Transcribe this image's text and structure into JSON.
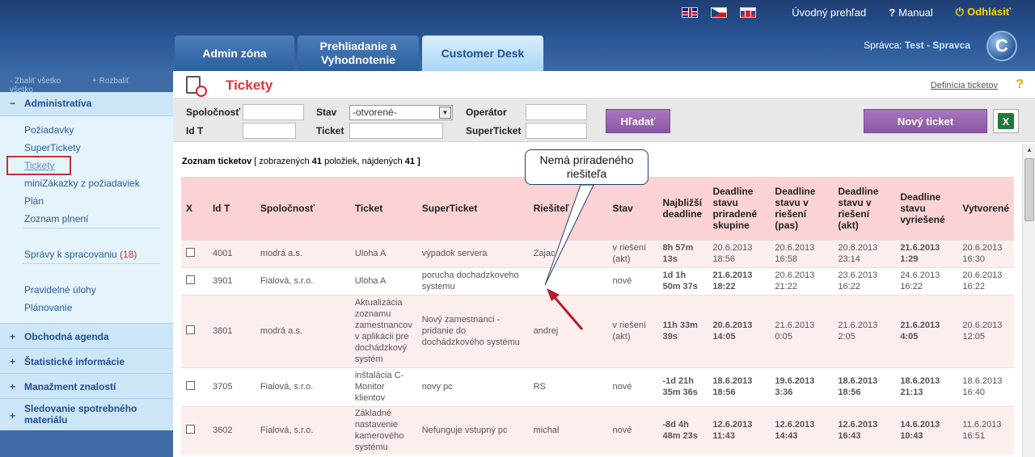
{
  "header": {
    "nav": {
      "overview": "Úvodný prehľad",
      "manual": "Manual",
      "logout": "Odhlásiť"
    },
    "tabs": [
      {
        "label": "Admin zóna"
      },
      {
        "label": "Prehliadanie a Vyhodnotenie"
      },
      {
        "label": "Customer Desk"
      }
    ],
    "admin_prefix": "Správca:",
    "admin_name": "Test - Spravca",
    "logo_letter": "C"
  },
  "sidebar": {
    "collapse_all": "Zbaliť všetko",
    "expand_all": "Rozbaliť všetko",
    "section_admin": "Administratíva",
    "items": [
      {
        "label": "Požiadavky"
      },
      {
        "label": "SuperTickety"
      },
      {
        "label": "Tickety"
      },
      {
        "label": "miniZákazky z požiadaviek"
      },
      {
        "label": "Plán"
      },
      {
        "label": "Zoznam plnení"
      },
      {
        "label": "Správy k spracovaniu"
      },
      {
        "label": "Pravidelné úlohy"
      },
      {
        "label": "Plánovanie"
      }
    ],
    "reports_count": "(18)",
    "sections": [
      {
        "label": "Obchodná agenda"
      },
      {
        "label": "Štatistické informácie"
      },
      {
        "label": "Manažment znalostí"
      },
      {
        "label": "Sledovanie spotrebného materiálu"
      }
    ]
  },
  "page": {
    "title": "Tickety",
    "definition_link": "Definícia ticketov",
    "help": "?"
  },
  "filters": {
    "company_label": "Spoločnosť",
    "status_label": "Stav",
    "status_value": "-otvorené-",
    "operator_label": "Operátor",
    "id_label": "Id T",
    "ticket_label": "Ticket",
    "superticket_label": "SuperTicket",
    "search_button": "Hľadať",
    "new_ticket_button": "Nový ticket"
  },
  "list": {
    "summary_prefix": "Zoznam ticketov",
    "summary_shown_text": "[ zobrazených",
    "shown": "41",
    "summary_items_text": "položiek, nájdených",
    "found": "41",
    "summary_end": "]",
    "columns": [
      "X",
      "Id T",
      "Spoločnosť",
      "Ticket",
      "SuperTicket",
      "Riešiteľ",
      "Stav",
      "Najbližší deadline",
      "Deadline stavu priradené skupine",
      "Deadline stavu v riešení (pas)",
      "Deadline stavu v riešení (akt)",
      "Deadline stavu vyriešené",
      "Vytvorené"
    ],
    "rows": [
      {
        "id": "4001",
        "company": "modrá a.s.",
        "ticket": "Uloha A",
        "superticket": "výpadok servera",
        "resolver": "Zajac",
        "status": "v riešení (akt)",
        "nearest": "8h 57m 13s",
        "d_group": "20.6.2013 18:56",
        "d_pas": "20.6.2013 16:58",
        "d_akt": "20.6.2013 23:14",
        "d_solved": "21.6.2013 1:29",
        "created": "20.6.2013 16:30"
      },
      {
        "id": "3901",
        "company": "Fialová, s.r.o.",
        "ticket": "Uloha A",
        "superticket": "porucha dochadzkoveho systemu",
        "resolver": "",
        "status": "nové",
        "nearest": "1d 1h 50m 37s",
        "d_group": "21.6.2013 18:22",
        "d_pas": "20.6.2013 21:22",
        "d_akt": "23.6.2013 16:22",
        "d_solved": "24.6.2013 16:22",
        "created": "20.6.2013 16:22"
      },
      {
        "id": "3801",
        "company": "modrá a.s.",
        "ticket": "Aktualizácia zoznamu zamestnancov v aplikácii pre dochádzkový systém",
        "superticket": "Nový zamestnanci - pridanie do dochádzkového systému",
        "resolver": "andrej",
        "status": "v riešení (akt)",
        "nearest": "11h 33m 39s",
        "d_group": "20.6.2013 14:05",
        "d_pas": "21.6.2013 0:05",
        "d_akt": "21.6.2013 2:05",
        "d_solved": "21.6.2013 4:05",
        "created": "20.6.2013 12:05"
      },
      {
        "id": "3705",
        "company": "Fialová, s.r.o.",
        "ticket": "inštalácia C-Monitor klientov",
        "superticket": "novy pc",
        "resolver": "RS",
        "status": "nové",
        "nearest": "-1d 21h 35m 36s",
        "d_group": "18.6.2013 18:56",
        "d_pas": "19.6.2013 3:36",
        "d_akt": "18.6.2013 18:56",
        "d_solved": "18.6.2013 21:13",
        "created": "18.6.2013 16:40"
      },
      {
        "id": "3602",
        "company": "Fialová, s.r.o.",
        "ticket": "Základné nastavenie kamerového systému",
        "superticket": "Nefunguje vstupný pc",
        "resolver": "michal",
        "status": "nové",
        "nearest": "-8d 4h 48m 23s",
        "d_group": "12.6.2013 11:43",
        "d_pas": "12.6.2013 14:43",
        "d_akt": "12.6.2013 16:43",
        "d_solved": "14.6.2013 10:43",
        "created": "11.6.2013 16:51"
      }
    ]
  },
  "callout": {
    "text": "Nemá priradeného riešiteľa"
  },
  "colors": {
    "brand_blue": "#2a5796",
    "title_red": "#e03434",
    "button_purple": "#8b56a5",
    "header_pink": "#fbd3d5"
  }
}
